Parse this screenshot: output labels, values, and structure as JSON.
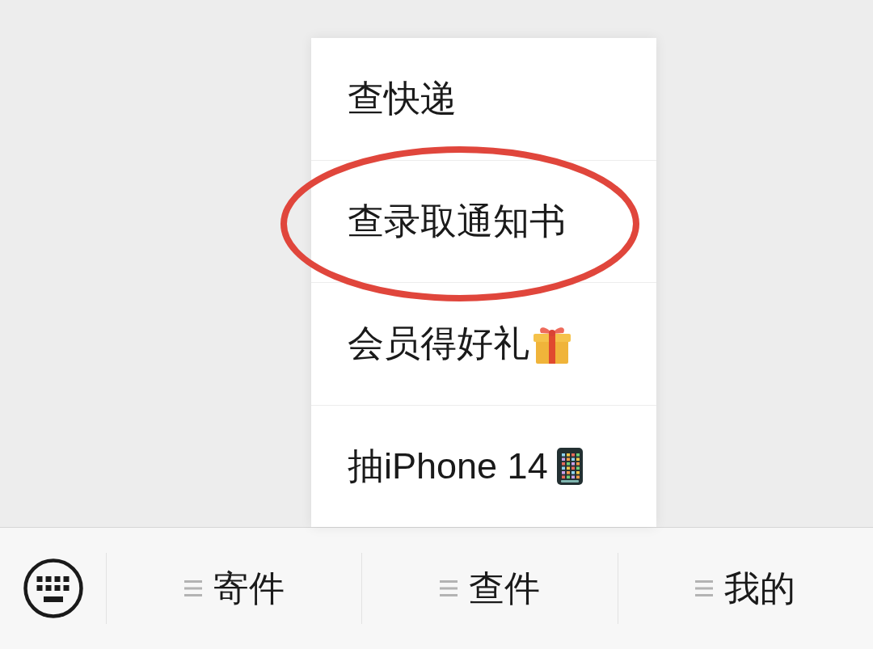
{
  "popup_menu": {
    "items": [
      {
        "label": "查快递",
        "kind": "text",
        "circled": false
      },
      {
        "label": "查录取通知书",
        "kind": "text",
        "circled": true
      },
      {
        "label": "会员得好礼",
        "kind": "gift",
        "circled": false
      },
      {
        "label": "抽iPhone 14",
        "kind": "phone",
        "circled": false
      }
    ]
  },
  "bottom_bar": {
    "menus": [
      {
        "label": "寄件"
      },
      {
        "label": "查件"
      },
      {
        "label": "我的"
      }
    ]
  }
}
